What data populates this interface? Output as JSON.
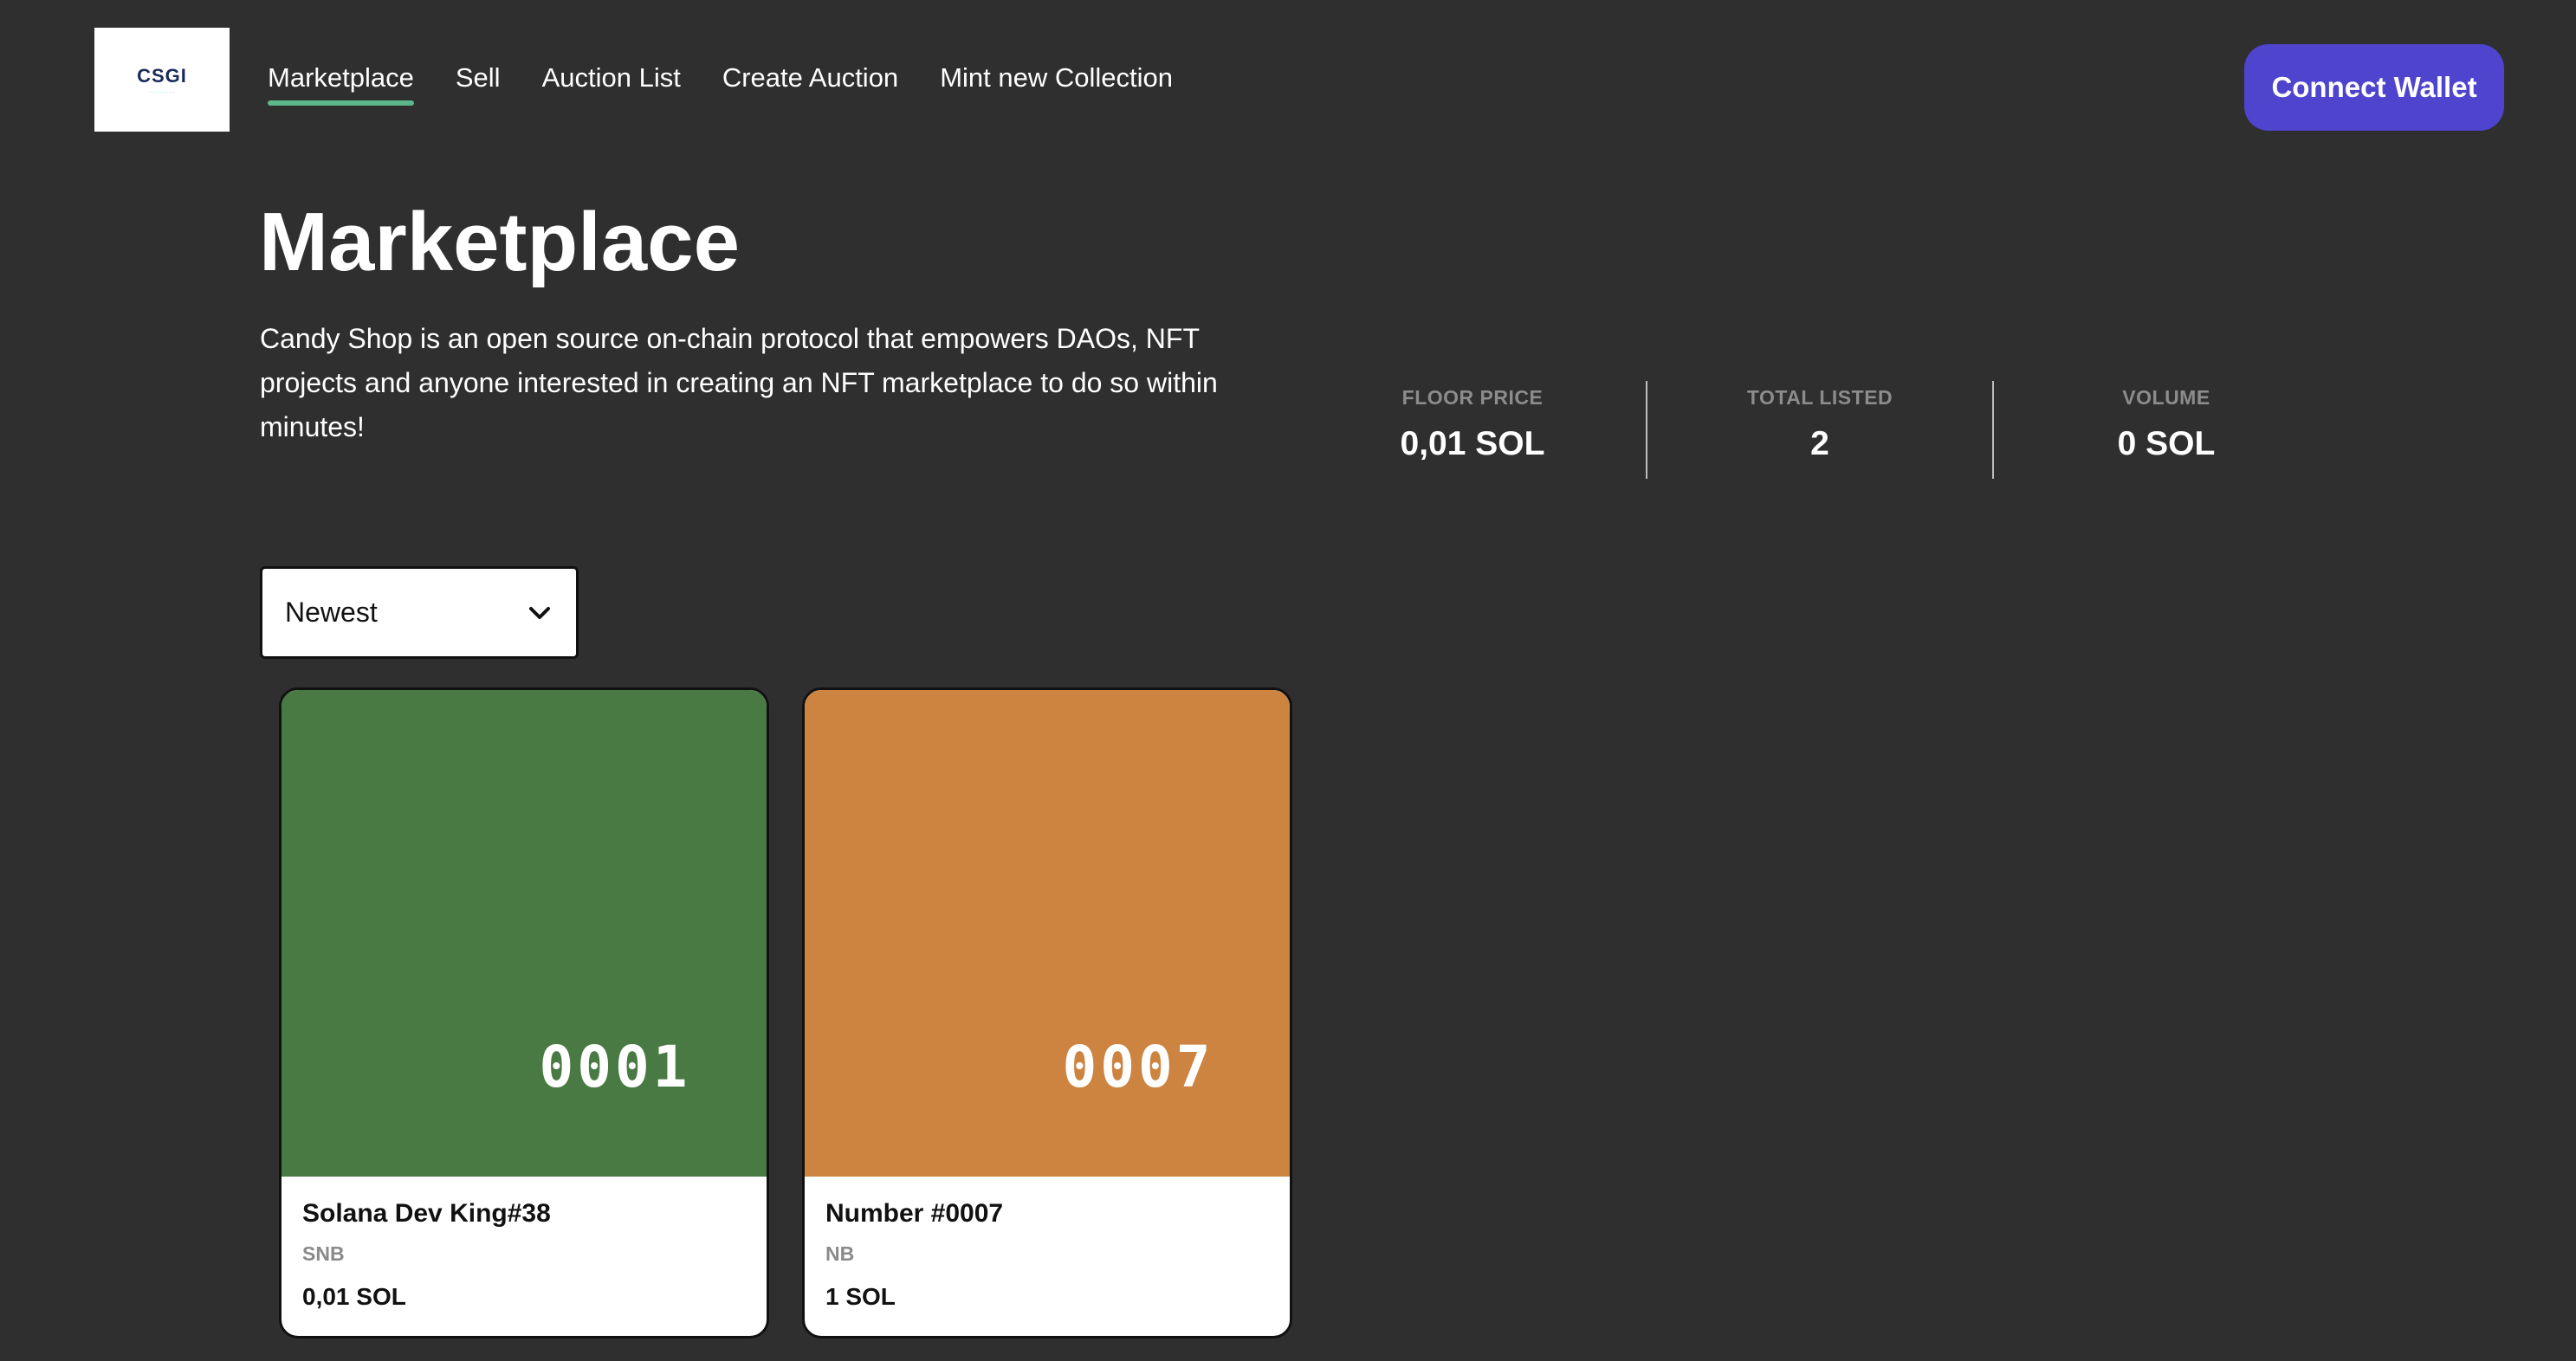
{
  "logo": {
    "text": "CSGI",
    "subtext": "············"
  },
  "nav": {
    "items": [
      {
        "label": "Marketplace",
        "active": true
      },
      {
        "label": "Sell",
        "active": false
      },
      {
        "label": "Auction List",
        "active": false
      },
      {
        "label": "Create Auction",
        "active": false
      },
      {
        "label": "Mint new Collection",
        "active": false
      }
    ]
  },
  "header": {
    "connect_label": "Connect Wallet"
  },
  "hero": {
    "title": "Marketplace",
    "description": "Candy Shop is an open source on-chain protocol that empowers DAOs, NFT projects and anyone interested in creating an NFT marketplace to do so within minutes!"
  },
  "stats": [
    {
      "label": "FLOOR PRICE",
      "value": "0,01 SOL"
    },
    {
      "label": "TOTAL LISTED",
      "value": "2"
    },
    {
      "label": "VOLUME",
      "value": "0 SOL"
    }
  ],
  "sort": {
    "selected": "Newest"
  },
  "cards": [
    {
      "name": "Solana Dev King#38",
      "symbol": "SNB",
      "price": "0,01 SOL",
      "number": "0001",
      "color": "#497a43"
    },
    {
      "name": "Number #0007",
      "symbol": "NB",
      "price": "1 SOL",
      "number": "0007",
      "color": "#cc8440"
    }
  ],
  "colors": {
    "background": "#2f2f2f",
    "accent": "#4e44ce",
    "nav_underline": "#5cb88a"
  }
}
